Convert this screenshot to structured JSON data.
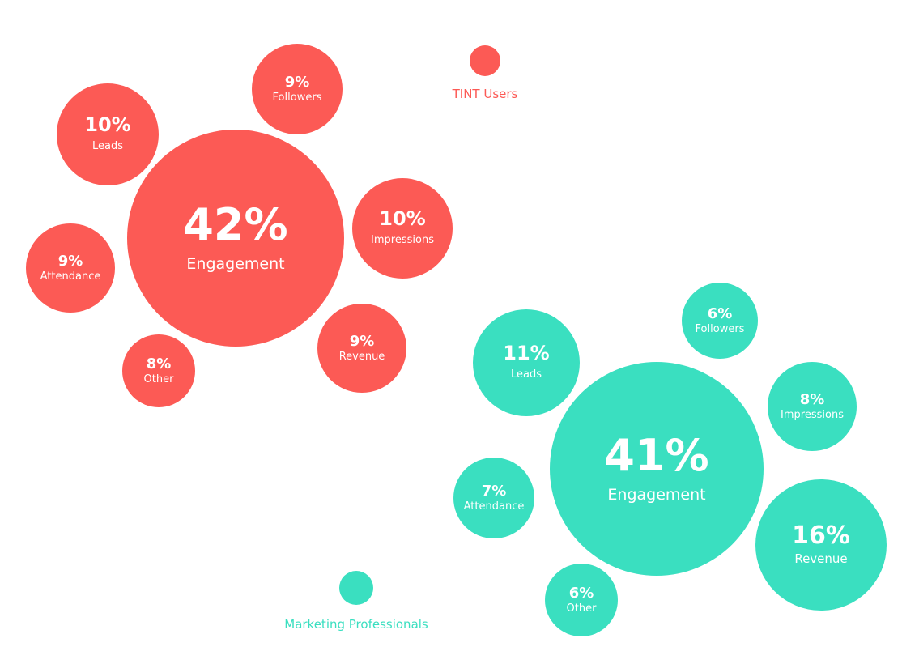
{
  "chart_data": {
    "type": "bubble",
    "title": "",
    "colors": {
      "TINT Users": "#FC5A55",
      "Marketing Professionals": "#3ADFC0"
    },
    "legend": [
      {
        "name": "TINT Users",
        "color": "#FC5A55"
      },
      {
        "name": "Marketing Professionals",
        "color": "#3ADFC0"
      }
    ],
    "series": [
      {
        "name": "TINT Users",
        "color": "#FC5A55",
        "points": [
          {
            "category": "Engagement",
            "value": 42,
            "label": "42%"
          },
          {
            "category": "Leads",
            "value": 10,
            "label": "10%"
          },
          {
            "category": "Followers",
            "value": 9,
            "label": "9%"
          },
          {
            "category": "Impressions",
            "value": 10,
            "label": "10%"
          },
          {
            "category": "Attendance",
            "value": 9,
            "label": "9%"
          },
          {
            "category": "Revenue",
            "value": 9,
            "label": "9%"
          },
          {
            "category": "Other",
            "value": 8,
            "label": "8%"
          }
        ]
      },
      {
        "name": "Marketing Professionals",
        "color": "#3ADFC0",
        "points": [
          {
            "category": "Engagement",
            "value": 41,
            "label": "41%"
          },
          {
            "category": "Leads",
            "value": 11,
            "label": "11%"
          },
          {
            "category": "Followers",
            "value": 6,
            "label": "6%"
          },
          {
            "category": "Impressions",
            "value": 8,
            "label": "8%"
          },
          {
            "category": "Attendance",
            "value": 7,
            "label": "7%"
          },
          {
            "category": "Revenue",
            "value": 16,
            "label": "16%"
          },
          {
            "category": "Other",
            "value": 6,
            "label": "6%"
          }
        ]
      }
    ]
  }
}
